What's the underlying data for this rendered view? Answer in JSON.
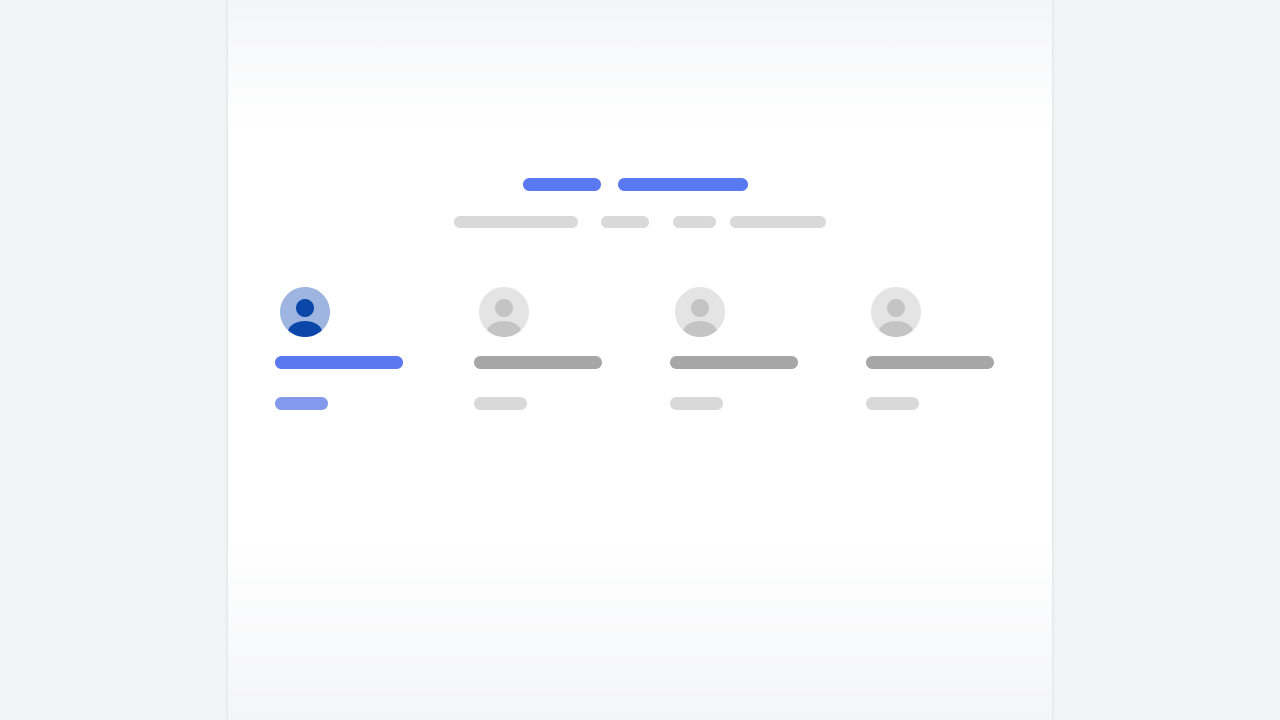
{
  "header": {
    "title_segments": [
      "",
      ""
    ],
    "meta_segments": [
      "",
      "",
      "",
      ""
    ]
  },
  "members": [
    {
      "name": "",
      "role": "",
      "selected": true,
      "avatar_icon": "user-avatar-icon"
    },
    {
      "name": "",
      "role": "",
      "selected": false,
      "avatar_icon": "user-avatar-icon"
    },
    {
      "name": "",
      "role": "",
      "selected": false,
      "avatar_icon": "user-avatar-icon"
    },
    {
      "name": "",
      "role": "",
      "selected": false,
      "avatar_icon": "user-avatar-icon"
    }
  ],
  "colors": {
    "accent": "#5a78f0",
    "accent_light": "#8299ec",
    "selected_avatar_bg": "#9db5e0",
    "selected_avatar_fg": "#0b47a8",
    "avatar_bg": "#e4e4e4",
    "avatar_fg": "#c4c4c4",
    "skeleton_dark": "#a6a6a6",
    "skeleton_light": "#d9d9d9"
  }
}
